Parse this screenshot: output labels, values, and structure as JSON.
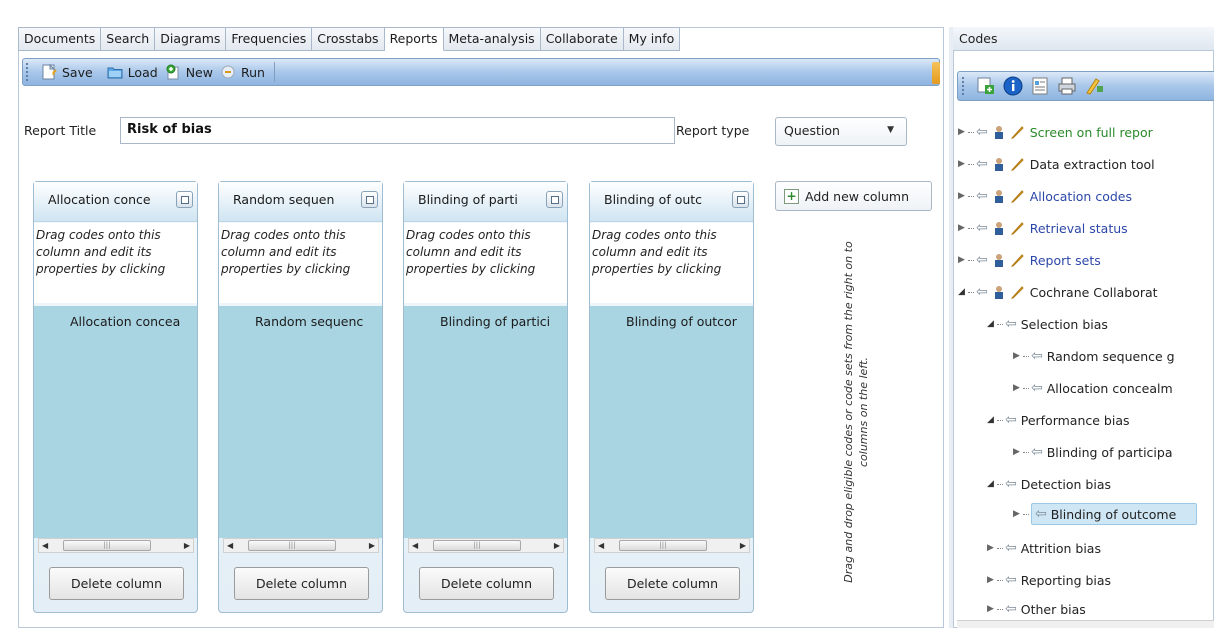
{
  "tabs": [
    {
      "label": "Documents",
      "active": false
    },
    {
      "label": "Search",
      "active": false
    },
    {
      "label": "Diagrams",
      "active": false
    },
    {
      "label": "Frequencies",
      "active": false
    },
    {
      "label": "Crosstabs",
      "active": false
    },
    {
      "label": "Reports",
      "active": true
    },
    {
      "label": "Meta-analysis",
      "active": false
    },
    {
      "label": "Collaborate",
      "active": false
    },
    {
      "label": "My info",
      "active": false
    }
  ],
  "toolbar": {
    "save_label": "Save",
    "load_label": "Load",
    "new_label": "New",
    "run_label": "Run"
  },
  "report": {
    "title_label": "Report Title",
    "title_value": "Risk of bias",
    "type_label": "Report type",
    "type_value": "Question"
  },
  "columns": [
    {
      "header": "Allocation conce",
      "hint": "Drag codes onto this column and edit its properties by clicking",
      "code": "Allocation concea",
      "delete_label": "Delete column"
    },
    {
      "header": "Random sequen",
      "hint": "Drag codes onto this column and edit its properties by clicking",
      "code": "Random sequenc",
      "delete_label": "Delete column"
    },
    {
      "header": "Blinding of parti",
      "hint": "Drag codes onto this column and edit its properties by clicking",
      "code": "Blinding of partici",
      "delete_label": "Delete column"
    },
    {
      "header": "Blinding of outc",
      "hint": "Drag codes onto this column and edit its properties by clicking",
      "code": "Blinding of outcor",
      "delete_label": "Delete column"
    }
  ],
  "add_column_label": "Add new column",
  "drag_hint": "Drag and drop eligible codes or code sets from the right on to columns on the left.",
  "codes_panel": {
    "title": "Codes",
    "tree": [
      {
        "label": "Screen on full repor",
        "color": "green",
        "set": true
      },
      {
        "label": "Data extraction tool",
        "color": "dark",
        "set": true
      },
      {
        "label": "Allocation codes",
        "color": "link",
        "set": true
      },
      {
        "label": "Retrieval status",
        "color": "link",
        "set": true
      },
      {
        "label": "Report sets",
        "color": "link",
        "set": true
      },
      {
        "label": "Cochrane Collaborat",
        "color": "dark",
        "set": true,
        "expanded": true
      },
      {
        "label": "Selection bias",
        "color": "dark",
        "expanded": true
      },
      {
        "label": "Random sequence g",
        "color": "dark"
      },
      {
        "label": "Allocation concealm",
        "color": "dark"
      },
      {
        "label": "Performance bias",
        "color": "dark",
        "expanded": true
      },
      {
        "label": "Blinding of participa",
        "color": "dark"
      },
      {
        "label": "Detection bias",
        "color": "dark",
        "expanded": true
      },
      {
        "label": "Blinding of outcome",
        "color": "dark",
        "selected": true
      },
      {
        "label": "Attrition bias",
        "color": "dark"
      },
      {
        "label": "Reporting bias",
        "color": "dark"
      },
      {
        "label": "Other bias",
        "color": "dark"
      }
    ]
  },
  "colors": {
    "accent": "#8db4e0",
    "column_body": "#a9d4e2",
    "link": "#2c47a8",
    "green": "#2a8a2a"
  }
}
